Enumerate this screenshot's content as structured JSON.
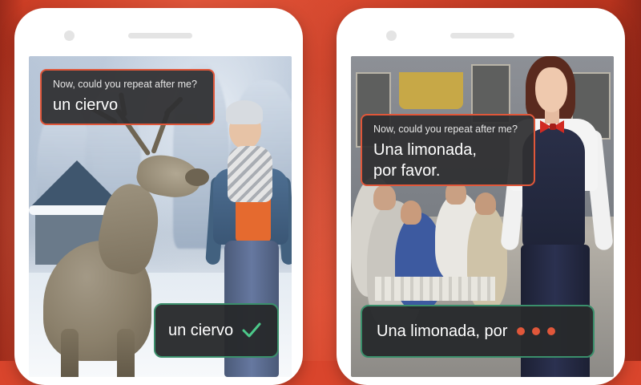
{
  "colors": {
    "background": "#d9452c",
    "bubble_border_prompt": "#e0573a",
    "bubble_border_answer": "#3a8f6b",
    "check": "#4cc98a",
    "dots": "#e0573a"
  },
  "left_phone": {
    "prompt": {
      "label": "Now, could you repeat after me?",
      "text": "un ciervo"
    },
    "answer": {
      "text": "un ciervo",
      "status_icon": "check-icon"
    }
  },
  "right_phone": {
    "prompt": {
      "label": "Now, could you repeat after me?",
      "text_line1": "Una limonada,",
      "text_line2": "por favor."
    },
    "answer": {
      "text": "Una limonada, por",
      "status_icon": "typing-dots-icon"
    }
  }
}
